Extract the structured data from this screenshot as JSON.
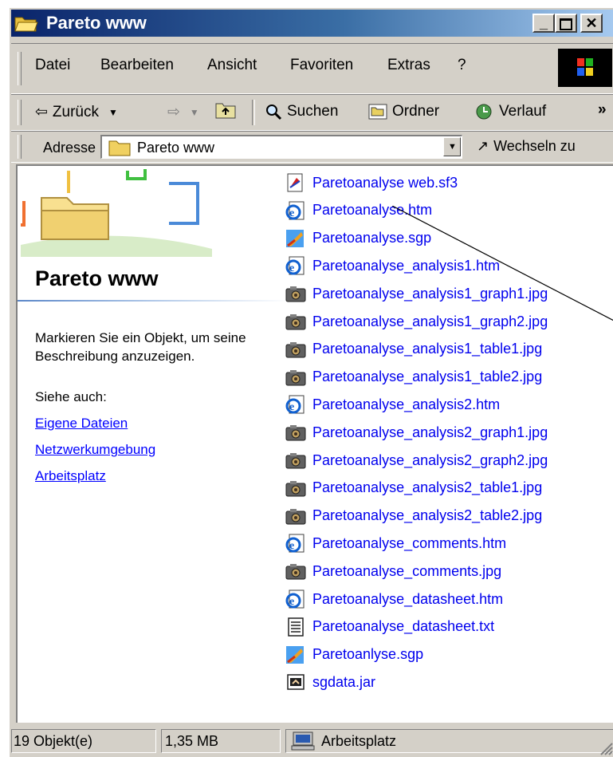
{
  "window": {
    "title": "Pareto www"
  },
  "menu": {
    "items": [
      "Datei",
      "Bearbeiten",
      "Ansicht",
      "Favoriten",
      "Extras",
      "?"
    ]
  },
  "toolbar": {
    "back": "Zurück",
    "search": "Suchen",
    "folders": "Ordner",
    "history": "Verlauf",
    "more": "»"
  },
  "address": {
    "label": "Adresse",
    "value": "Pareto www",
    "go": "Wechseln zu"
  },
  "sidebar": {
    "title": "Pareto www",
    "description": "Markieren Sie ein Objekt, um seine Beschreibung anzuzeigen.",
    "see_also": "Siehe auch:",
    "links": [
      "Eigene Dateien",
      "Netzwerkumgebung",
      "Arbeitsplatz"
    ]
  },
  "files": [
    {
      "name": "Paretoanalyse web.sf3",
      "icon": "sf3-file-icon"
    },
    {
      "name": "Paretoanalyse.htm",
      "icon": "ie-document-icon"
    },
    {
      "name": "Paretoanalyse.sgp",
      "icon": "sgp-file-icon"
    },
    {
      "name": "Paretoanalyse_analysis1.htm",
      "icon": "ie-document-icon"
    },
    {
      "name": "Paretoanalyse_analysis1_graph1.jpg",
      "icon": "jpg-image-icon"
    },
    {
      "name": "Paretoanalyse_analysis1_graph2.jpg",
      "icon": "jpg-image-icon"
    },
    {
      "name": "Paretoanalyse_analysis1_table1.jpg",
      "icon": "jpg-image-icon"
    },
    {
      "name": "Paretoanalyse_analysis1_table2.jpg",
      "icon": "jpg-image-icon"
    },
    {
      "name": "Paretoanalyse_analysis2.htm",
      "icon": "ie-document-icon"
    },
    {
      "name": "Paretoanalyse_analysis2_graph1.jpg",
      "icon": "jpg-image-icon"
    },
    {
      "name": "Paretoanalyse_analysis2_graph2.jpg",
      "icon": "jpg-image-icon"
    },
    {
      "name": "Paretoanalyse_analysis2_table1.jpg",
      "icon": "jpg-image-icon"
    },
    {
      "name": "Paretoanalyse_analysis2_table2.jpg",
      "icon": "jpg-image-icon"
    },
    {
      "name": "Paretoanalyse_comments.htm",
      "icon": "ie-document-icon"
    },
    {
      "name": "Paretoanalyse_comments.jpg",
      "icon": "jpg-image-icon"
    },
    {
      "name": "Paretoanalyse_datasheet.htm",
      "icon": "ie-document-icon"
    },
    {
      "name": "Paretoanalyse_datasheet.txt",
      "icon": "text-file-icon"
    },
    {
      "name": "Paretoanlyse.sgp",
      "icon": "sgp-file-icon"
    },
    {
      "name": "sgdata.jar",
      "icon": "jar-file-icon"
    }
  ],
  "status": {
    "objects": "19 Objekt(e)",
    "size": "1,35 MB",
    "zone": "Arbeitsplatz"
  }
}
